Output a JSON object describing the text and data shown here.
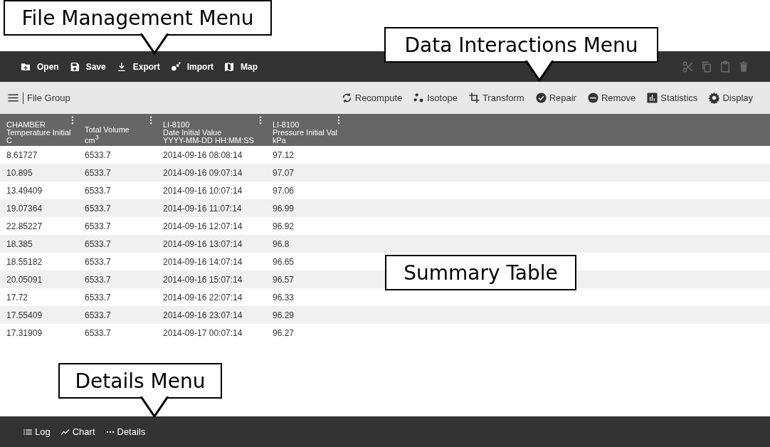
{
  "file_menu": [
    {
      "kind": "open",
      "label": "Open"
    },
    {
      "kind": "save",
      "label": "Save"
    },
    {
      "kind": "export",
      "label": "Export"
    },
    {
      "kind": "import",
      "label": "Import"
    },
    {
      "kind": "map",
      "label": "Map"
    }
  ],
  "edit_tools": [
    {
      "kind": "cut",
      "disabled": true
    },
    {
      "kind": "copy",
      "disabled": true
    },
    {
      "kind": "paste",
      "disabled": true
    },
    {
      "kind": "delete",
      "disabled": true
    }
  ],
  "group_label": "File Group",
  "data_menu": [
    {
      "kind": "recompute",
      "label": "Recompute"
    },
    {
      "kind": "isotope",
      "label": "Isotope"
    },
    {
      "kind": "transform",
      "label": "Transform"
    },
    {
      "kind": "repair",
      "label": "Repair"
    },
    {
      "kind": "remove",
      "label": "Remove"
    },
    {
      "kind": "statistics",
      "label": "Statistics"
    },
    {
      "kind": "display",
      "label": "Display"
    }
  ],
  "table": {
    "columns": [
      {
        "lines": [
          "CHAMBER",
          "Temperature Initial",
          "C"
        ]
      },
      {
        "lines": [
          "Total Volume",
          "cm$^{3}$"
        ]
      },
      {
        "lines": [
          "LI-8100",
          "Date Initial Value",
          "YYYY-MM-DD HH:MM:SS"
        ]
      },
      {
        "lines": [
          "LI-8100",
          "Pressure Initial Val",
          "kPa"
        ]
      }
    ],
    "rows": [
      [
        "8.61727",
        "6533.7",
        "2014-09-16 08:08:14",
        "97.12"
      ],
      [
        "10.895",
        "6533.7",
        "2014-09-16 09:07:14",
        "97.07"
      ],
      [
        "13.49409",
        "6533.7",
        "2014-09-16 10:07:14",
        "97.06"
      ],
      [
        "19.07364",
        "6533.7",
        "2014-09-16 11:07:14",
        "96.99"
      ],
      [
        "22.85227",
        "6533.7",
        "2014-09-16 12:07:14",
        "96.92"
      ],
      [
        "18.385",
        "6533.7",
        "2014-09-16 13:07:14",
        "96.8"
      ],
      [
        "18.55182",
        "6533.7",
        "2014-09-16 14:07:14",
        "96.65"
      ],
      [
        "20.05091",
        "6533.7",
        "2014-09-16 15:07:14",
        "96.57"
      ],
      [
        "17.72",
        "6533.7",
        "2014-09-16 22:07:14",
        "96.33"
      ],
      [
        "17.55409",
        "6533.7",
        "2014-09-16 23:07:14",
        "96.29"
      ],
      [
        "17.31909",
        "6533.7",
        "2014-09-17 00:07:14",
        "96.27"
      ]
    ]
  },
  "details_menu": [
    {
      "kind": "log",
      "label": "Log"
    },
    {
      "kind": "chart",
      "label": "Chart"
    },
    {
      "kind": "details",
      "label": "Details"
    }
  ],
  "callouts": [
    {
      "text": "File Management Menu",
      "pointer": true
    },
    {
      "text": "Data Interactions Menu",
      "pointer": true
    },
    {
      "text": "Summary Table",
      "pointer": false
    },
    {
      "text": "Details Menu",
      "pointer": true
    }
  ]
}
